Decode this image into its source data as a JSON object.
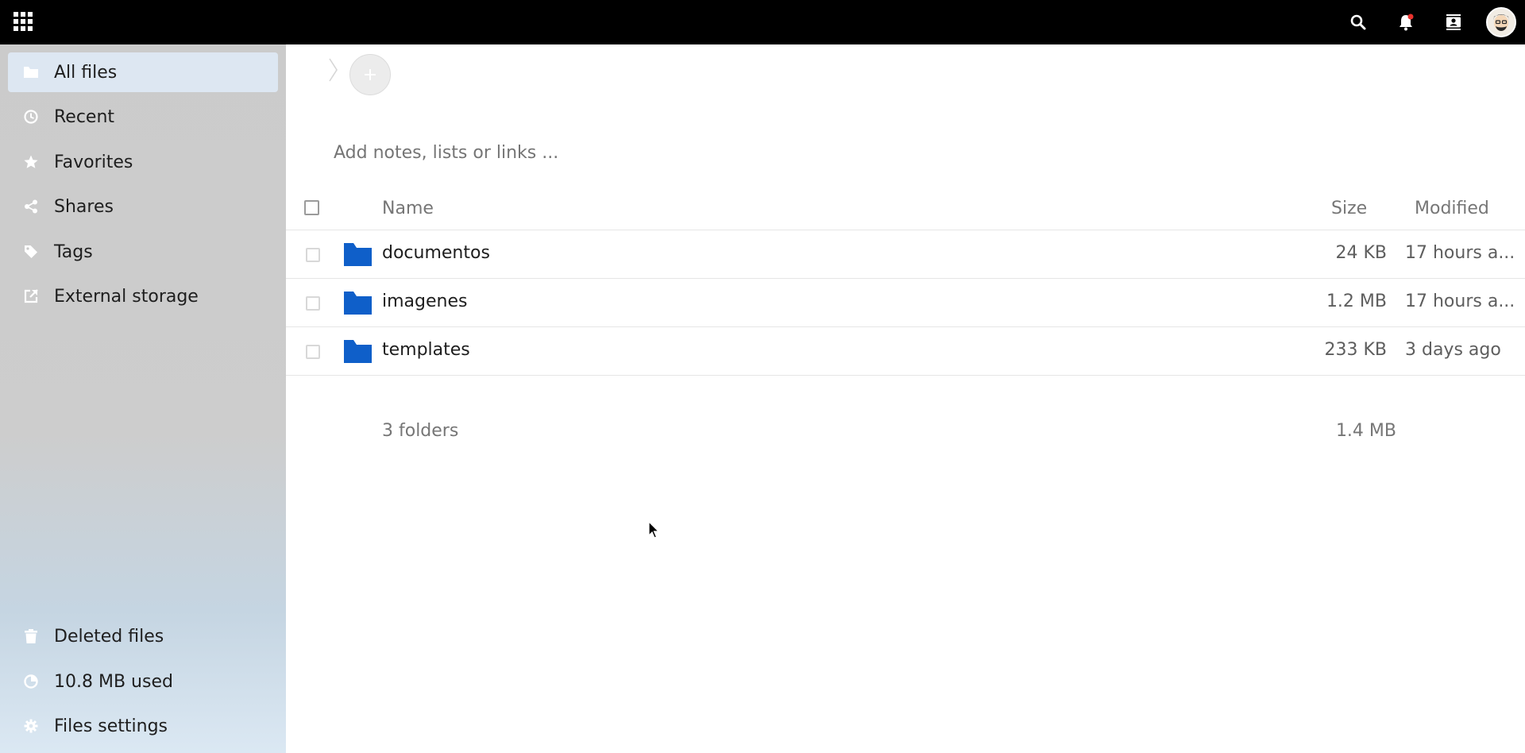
{
  "sidebar": {
    "items": [
      {
        "label": "All files"
      },
      {
        "label": "Recent"
      },
      {
        "label": "Favorites"
      },
      {
        "label": "Shares"
      },
      {
        "label": "Tags"
      },
      {
        "label": "External storage"
      }
    ],
    "bottom": [
      {
        "label": "Deleted files"
      },
      {
        "label": "10.8 MB used"
      },
      {
        "label": "Files settings"
      }
    ]
  },
  "main": {
    "notes_placeholder": "Add notes, lists or links ...",
    "columns": {
      "name": "Name",
      "size": "Size",
      "modified": "Modified"
    },
    "files": [
      {
        "name": "documentos",
        "size": "24 KB",
        "modified": "17 hours a..."
      },
      {
        "name": "imagenes",
        "size": "1.2 MB",
        "modified": "17 hours a..."
      },
      {
        "name": "templates",
        "size": "233 KB",
        "modified": "3 days ago"
      }
    ],
    "summary": {
      "count": "3 folders",
      "total": "1.4 MB"
    }
  },
  "colors": {
    "folder": "#0f5fc9",
    "header": "#000000",
    "active_nav": "#dde7f2",
    "notification_dot": "#e9322d"
  },
  "icons": [
    "app-menu-icon",
    "search-icon",
    "bell-icon",
    "contacts-icon",
    "folder-icon",
    "clock-icon",
    "star-icon",
    "share-icon",
    "tag-icon",
    "external-link-icon",
    "trash-icon",
    "pie-chart-icon",
    "gear-icon",
    "plus-icon"
  ]
}
